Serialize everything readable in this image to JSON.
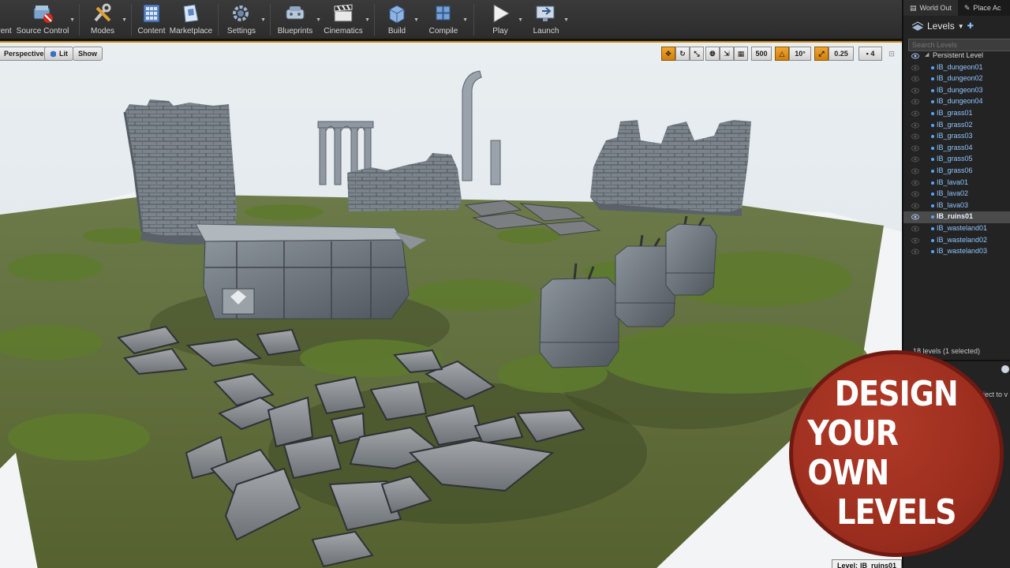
{
  "toolbar": {
    "items": [
      {
        "label": "rent",
        "icon": "save-icon"
      },
      {
        "label": "Source Control",
        "icon": "source-control-icon"
      },
      {
        "label": "Modes",
        "icon": "modes-icon"
      },
      {
        "label": "Content",
        "icon": "content-browser-icon"
      },
      {
        "label": "Marketplace",
        "icon": "marketplace-icon"
      },
      {
        "label": "Settings",
        "icon": "settings-icon"
      },
      {
        "label": "Blueprints",
        "icon": "blueprints-icon"
      },
      {
        "label": "Cinematics",
        "icon": "cinematics-icon"
      },
      {
        "label": "Build",
        "icon": "build-icon"
      },
      {
        "label": "Compile",
        "icon": "compile-icon"
      },
      {
        "label": "Play",
        "icon": "play-icon"
      },
      {
        "label": "Launch",
        "icon": "launch-icon"
      }
    ]
  },
  "viewport": {
    "perspective_label": "Perspective",
    "lit_label": "Lit",
    "show_label": "Show",
    "grid_size": "500",
    "rotation_snap": "10°",
    "scale_snap": "0.25",
    "camera_speed": "4",
    "level_status_label": "Level:",
    "level_status_value": "IB_ruins01"
  },
  "right_panel": {
    "tabs": [
      "World Out",
      "Place Ac"
    ],
    "levels_title": "Levels",
    "search_placeholder": "Search Levels",
    "persistent_level": "Persistent Level",
    "levels": [
      "IB_dungeon01",
      "IB_dungeon02",
      "IB_dungeon03",
      "IB_dungeon04",
      "IB_grass01",
      "IB_grass02",
      "IB_grass03",
      "IB_grass04",
      "IB_grass05",
      "IB_grass06",
      "IB_lava01",
      "IB_lava02",
      "IB_lava03",
      "IB_ruins01",
      "IB_wasteland01",
      "IB_wasteland02",
      "IB_wasteland03"
    ],
    "selected_level": "IB_ruins01",
    "count_text": "18 levels (1 selected)",
    "details_fragment": "bject to v"
  },
  "promo": {
    "lines": [
      "DESIGN",
      "YOUR OWN",
      "LEVELS"
    ],
    "color": "#9c2e1e"
  },
  "colors": {
    "accent_orange": "#e59320",
    "level_blue": "#8fc4ff",
    "panel_bg": "#232323"
  }
}
